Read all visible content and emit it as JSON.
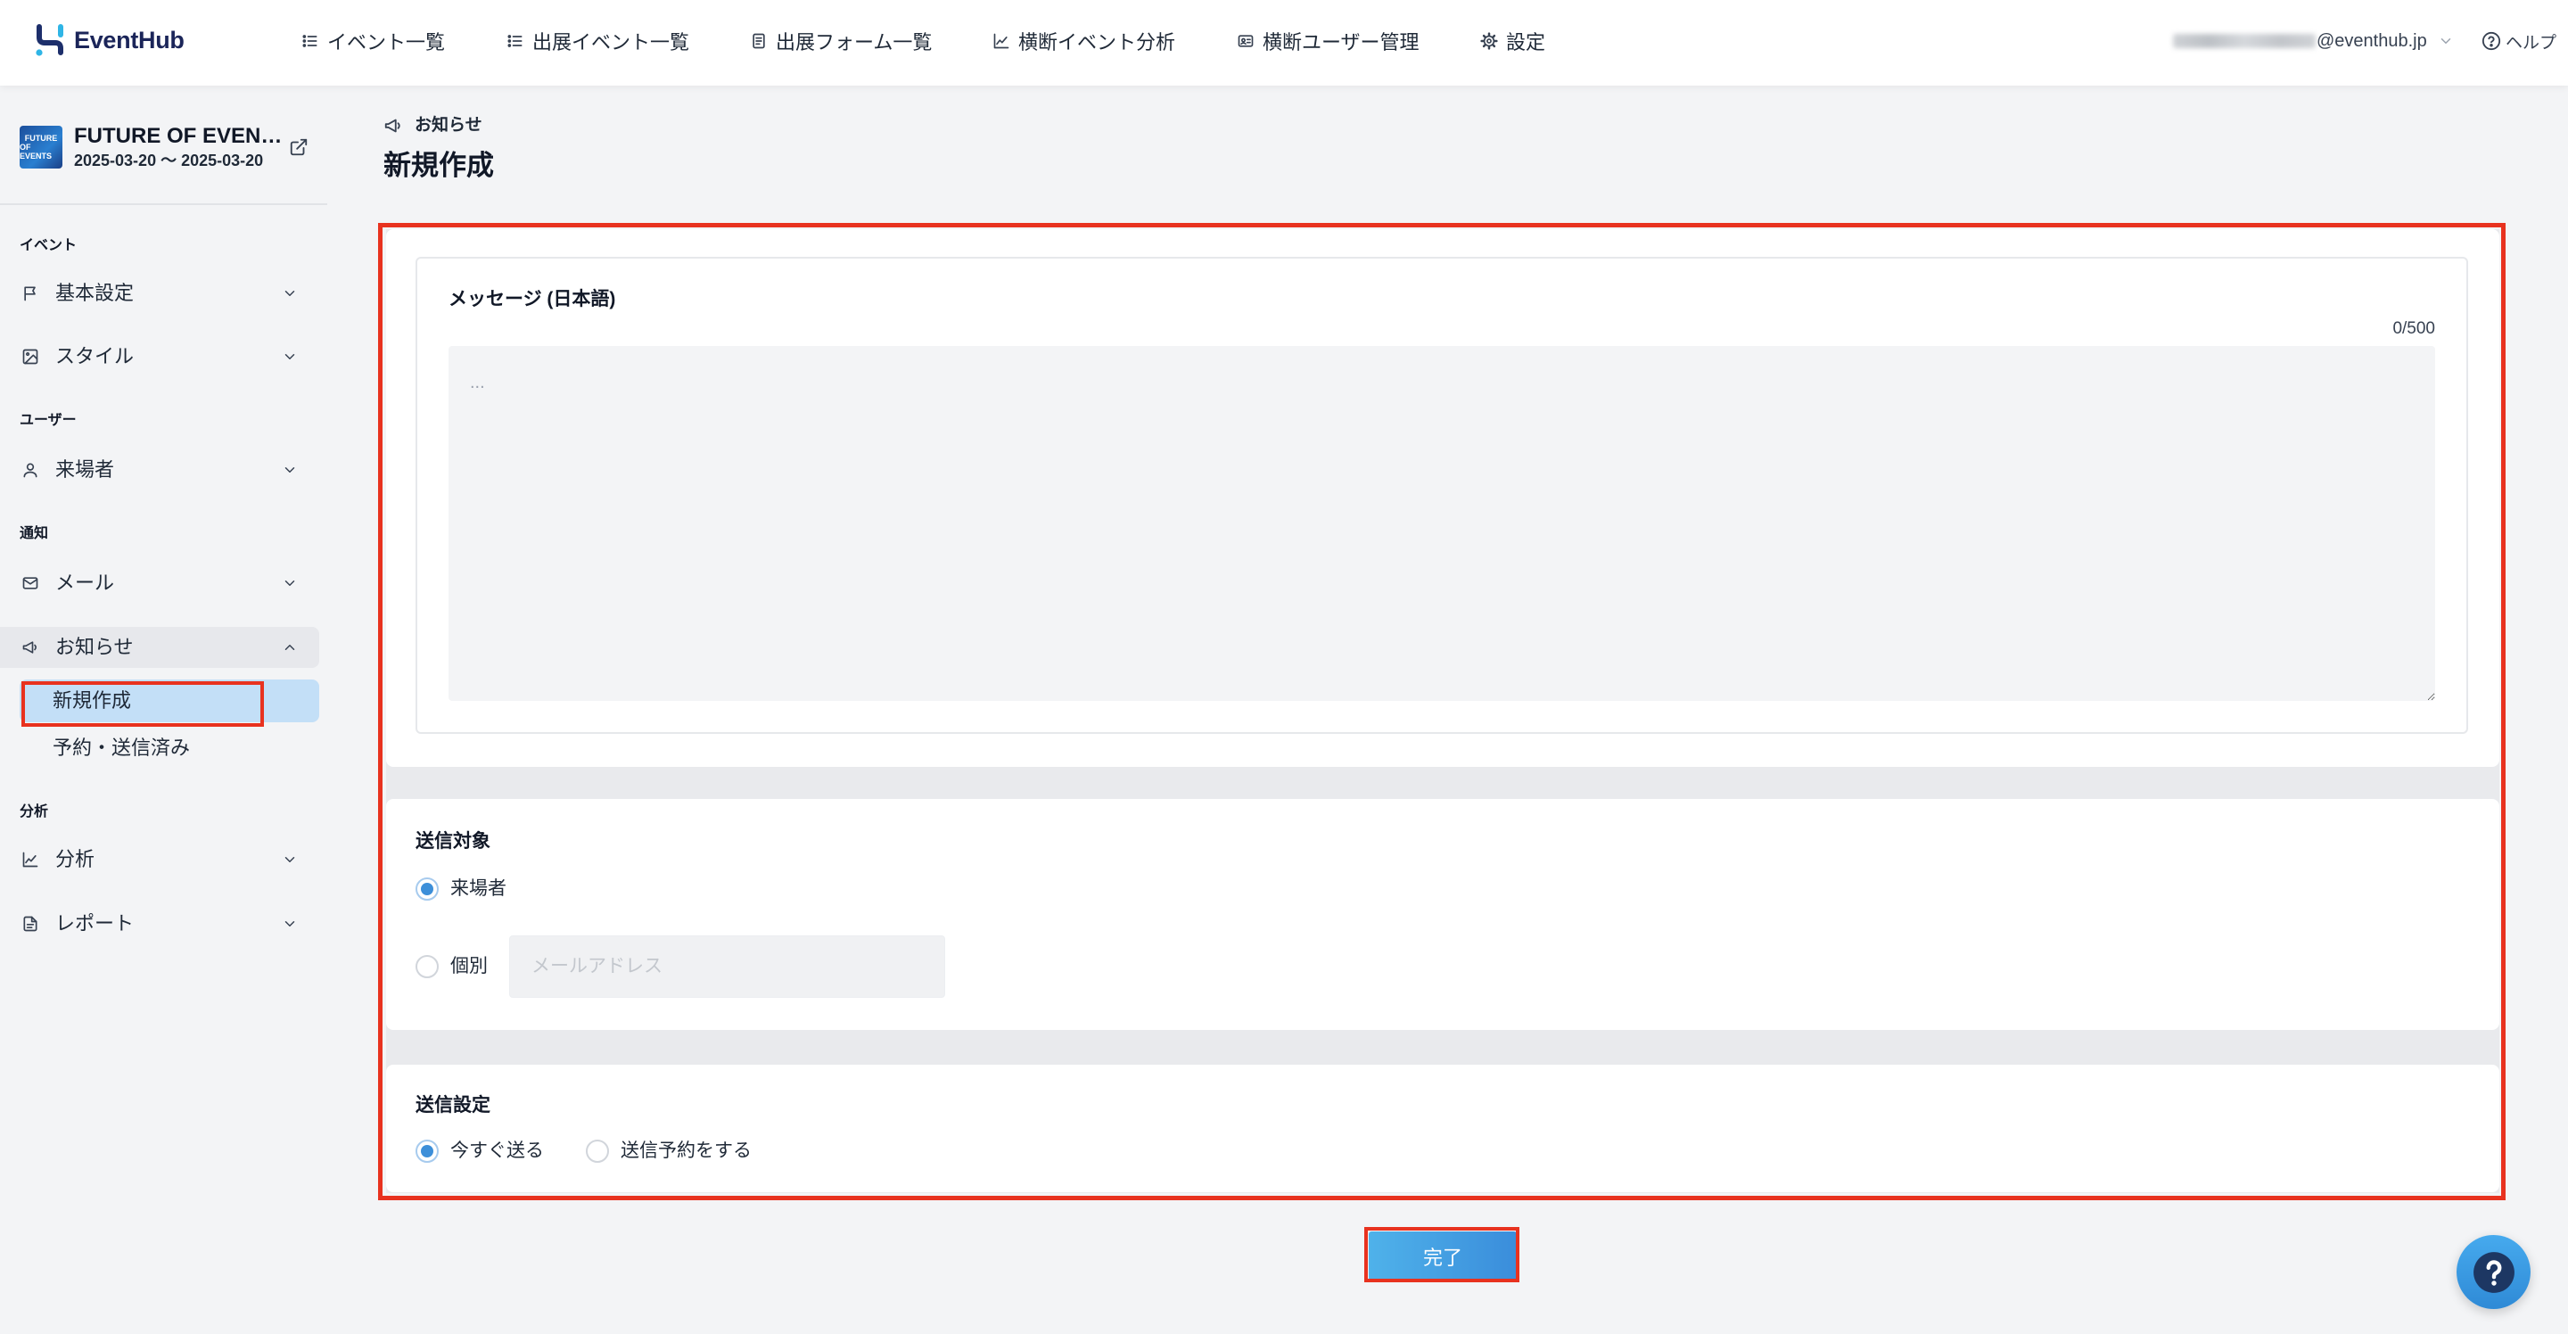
{
  "app": {
    "brand": "EventHub"
  },
  "header": {
    "nav": [
      {
        "label": "イベント一覧",
        "icon": "list-icon"
      },
      {
        "label": "出展イベント一覧",
        "icon": "list-icon"
      },
      {
        "label": "出展フォーム一覧",
        "icon": "form-icon"
      },
      {
        "label": "横断イベント分析",
        "icon": "line-chart-icon"
      },
      {
        "label": "横断ユーザー管理",
        "icon": "id-card-icon"
      },
      {
        "label": "設定",
        "icon": "gear-icon"
      }
    ],
    "account": {
      "email_domain": "@eventhub.jp",
      "icon": "chevron-down-icon"
    },
    "help": {
      "label": "ヘルプ",
      "icon": "help-circle-icon"
    }
  },
  "sidebar": {
    "event": {
      "thumbnail_lines": [
        "FUTURE",
        "OF EVENTS"
      ],
      "title": "FUTURE OF EVEN…",
      "dates": "2025-03-20 〜 2025-03-20",
      "link_icon": "external-link-icon"
    },
    "sections": [
      {
        "heading": "イベント",
        "items": [
          {
            "label": "基本設定",
            "icon": "flag-icon",
            "expanded": false
          },
          {
            "label": "スタイル",
            "icon": "image-icon",
            "expanded": false
          }
        ]
      },
      {
        "heading": "ユーザー",
        "items": [
          {
            "label": "来場者",
            "icon": "user-icon",
            "expanded": false
          }
        ]
      },
      {
        "heading": "通知",
        "items": [
          {
            "label": "メール",
            "icon": "mail-icon",
            "expanded": false
          },
          {
            "label": "お知らせ",
            "icon": "megaphone-icon",
            "expanded": true,
            "children": [
              {
                "label": "新規作成",
                "active": true
              },
              {
                "label": "予約・送信済み",
                "active": false
              }
            ]
          }
        ]
      },
      {
        "heading": "分析",
        "items": [
          {
            "label": "分析",
            "icon": "line-chart-icon",
            "expanded": false
          },
          {
            "label": "レポート",
            "icon": "report-icon",
            "expanded": false
          }
        ]
      }
    ]
  },
  "main": {
    "breadcrumb": {
      "label": "お知らせ",
      "icon": "megaphone-icon"
    },
    "title": "新規作成",
    "message": {
      "label": "メッセージ (日本語)",
      "counter": "0/500",
      "placeholder": "...",
      "value": ""
    },
    "recipients": {
      "label": "送信対象",
      "options": [
        {
          "label": "来場者",
          "selected": true
        },
        {
          "label": "個別",
          "selected": false
        }
      ],
      "email_placeholder": "メールアドレス",
      "email_value": ""
    },
    "schedule": {
      "label": "送信設定",
      "options": [
        {
          "label": "今すぐ送る",
          "selected": true
        },
        {
          "label": "送信予約をする",
          "selected": false
        }
      ]
    },
    "submit": {
      "label": "完了"
    }
  },
  "help_fab": {
    "icon": "question-icon"
  },
  "colors": {
    "accent": "#3d8fd9",
    "annotation_red": "#e8321f",
    "active_row": "#c3dff7",
    "page_bg": "#f3f4f6"
  }
}
